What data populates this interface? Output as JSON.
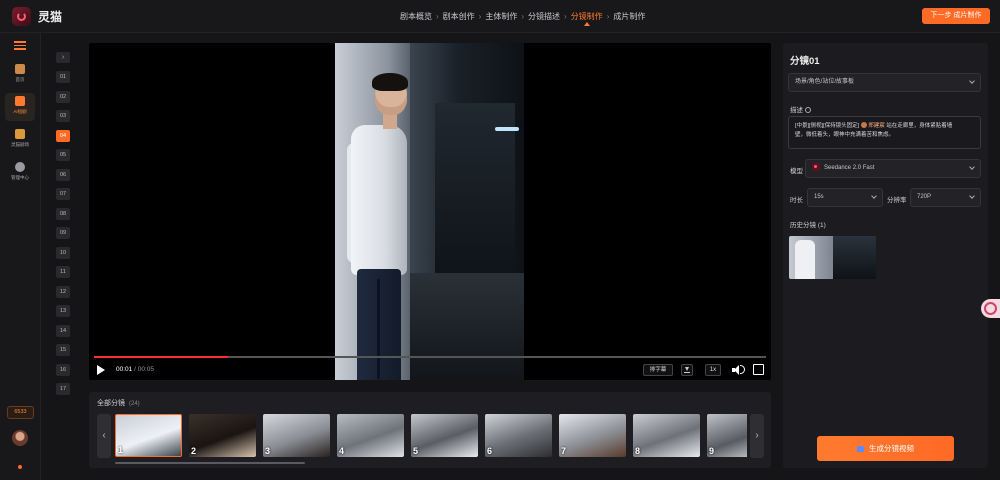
{
  "app": {
    "name": "灵猫"
  },
  "steps": [
    {
      "label": "剧本概览"
    },
    {
      "label": "剧本创作"
    },
    {
      "label": "主体制作"
    },
    {
      "label": "分镜描述"
    },
    {
      "label": "分镜制作",
      "active": true
    },
    {
      "label": "成片制作"
    }
  ],
  "header": {
    "next_label": "下一步 成片制作"
  },
  "nav": {
    "items": [
      {
        "label": "首页",
        "icon": "home-icon"
      },
      {
        "label": "AI短剧",
        "icon": "clapper-icon",
        "active": true
      },
      {
        "label": "灵猫剧场",
        "icon": "cat-icon"
      },
      {
        "label": "管理中心",
        "icon": "gear-icon"
      }
    ],
    "credits": "6533"
  },
  "shots": [
    "01",
    "02",
    "03",
    "04",
    "05",
    "06",
    "07",
    "08",
    "09",
    "10",
    "11",
    "12",
    "13",
    "14",
    "15",
    "16",
    "17"
  ],
  "active_shot": "04",
  "player": {
    "current_time": "00:01",
    "separator": " / ",
    "duration": "00:05",
    "progress": 0.2,
    "subtitle_label": "排字幕",
    "speed": "1x"
  },
  "filmstrip": {
    "title": "全部分镜",
    "count": "(24)",
    "thumbs": [
      "1",
      "2",
      "3",
      "4",
      "5",
      "6",
      "7",
      "8",
      "9"
    ],
    "selected": "1"
  },
  "panel": {
    "title": "分镜01",
    "scene_select": "场景/角色/站位/故事板",
    "desc_label": "描述",
    "desc_info_icon": "info-icon",
    "description_line1": "[中景][侧视][保持镜头固定]",
    "description_mention": "郑建宸",
    "description_line1b": "站在走廊里，身体紧贴着墙",
    "description_line2": "壁，微低着头，眼神中充满着苦和焦虑。",
    "model_label": "模型",
    "model_value": "Seedance 2.0 Fast",
    "duration_label": "时长",
    "duration_value": "15s",
    "resolution_label": "分辨率",
    "resolution_value": "720P",
    "history_label": "历史分镜",
    "history_count": "(1)",
    "generate_label": "生成分镜视频"
  },
  "colors": {
    "accent": "#ff6a25",
    "progress": "#ff2e3a",
    "bg": "#151518"
  }
}
